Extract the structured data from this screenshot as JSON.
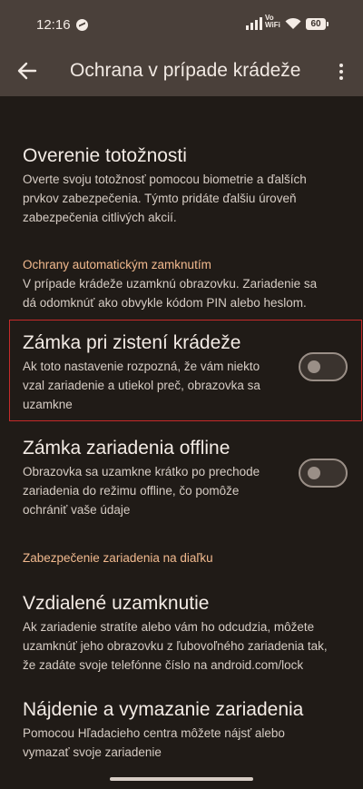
{
  "status_bar": {
    "time": "12:16",
    "vowifi_line1": "Vo",
    "vowifi_line2": "WiFi",
    "battery": "60"
  },
  "app_bar": {
    "title": "Ochrana v prípade krádeže"
  },
  "identity": {
    "title": "Overenie totožnosti",
    "desc_lines": [
      "Overte svoju totožnosť pomocou biometrie a ďalších",
      "prvkov zabezpečenia. Týmto pridáte ďalšiu úroveň",
      "zabezpečenia citlivých akcií."
    ]
  },
  "auto_lock_section": {
    "heading": "Ochrany automatickým zamknutím",
    "desc_lines": [
      "V prípade krádeže uzamknú obrazovku. Zariadenie sa",
      "dá odomknúť ako obvykle kódom PIN alebo heslom."
    ]
  },
  "theft_lock": {
    "title": "Zámka pri zistení krádeže",
    "desc_lines": [
      "Ak toto nastavenie rozpozná, že vám niekto",
      "vzal zariadenie a utiekol preč, obrazovka sa",
      "uzamkne"
    ],
    "enabled": false
  },
  "offline_lock": {
    "title": "Zámka zariadenia offline",
    "desc_lines": [
      "Obrazovka sa uzamkne krátko po prechode",
      "zariadenia do režimu offline, čo pomôže",
      "ochrániť vaše údaje"
    ],
    "enabled": false
  },
  "remote_section": {
    "heading": "Zabezpečenie zariadenia na diaľku"
  },
  "remote_lock": {
    "title": "Vzdialené uzamknutie",
    "desc_lines": [
      "Ak zariadenie stratíte alebo vám ho odcudzia, môžete",
      "uzamknúť jeho obrazovku z ľubovoľného zariadenia tak,",
      "že zadáte svoje telefónne číslo na android.com/lock"
    ]
  },
  "find_erase": {
    "title": "Nájdenie a vymazanie zariadenia",
    "desc_lines": [
      "Pomocou Hľadacieho centra môžete nájsť alebo",
      "vymazať svoje zariadenie"
    ]
  },
  "colors": {
    "accent": "#f1b98e",
    "highlight_border": "#c62a2a",
    "app_bar": "#4a403a",
    "background": "#201b17"
  }
}
